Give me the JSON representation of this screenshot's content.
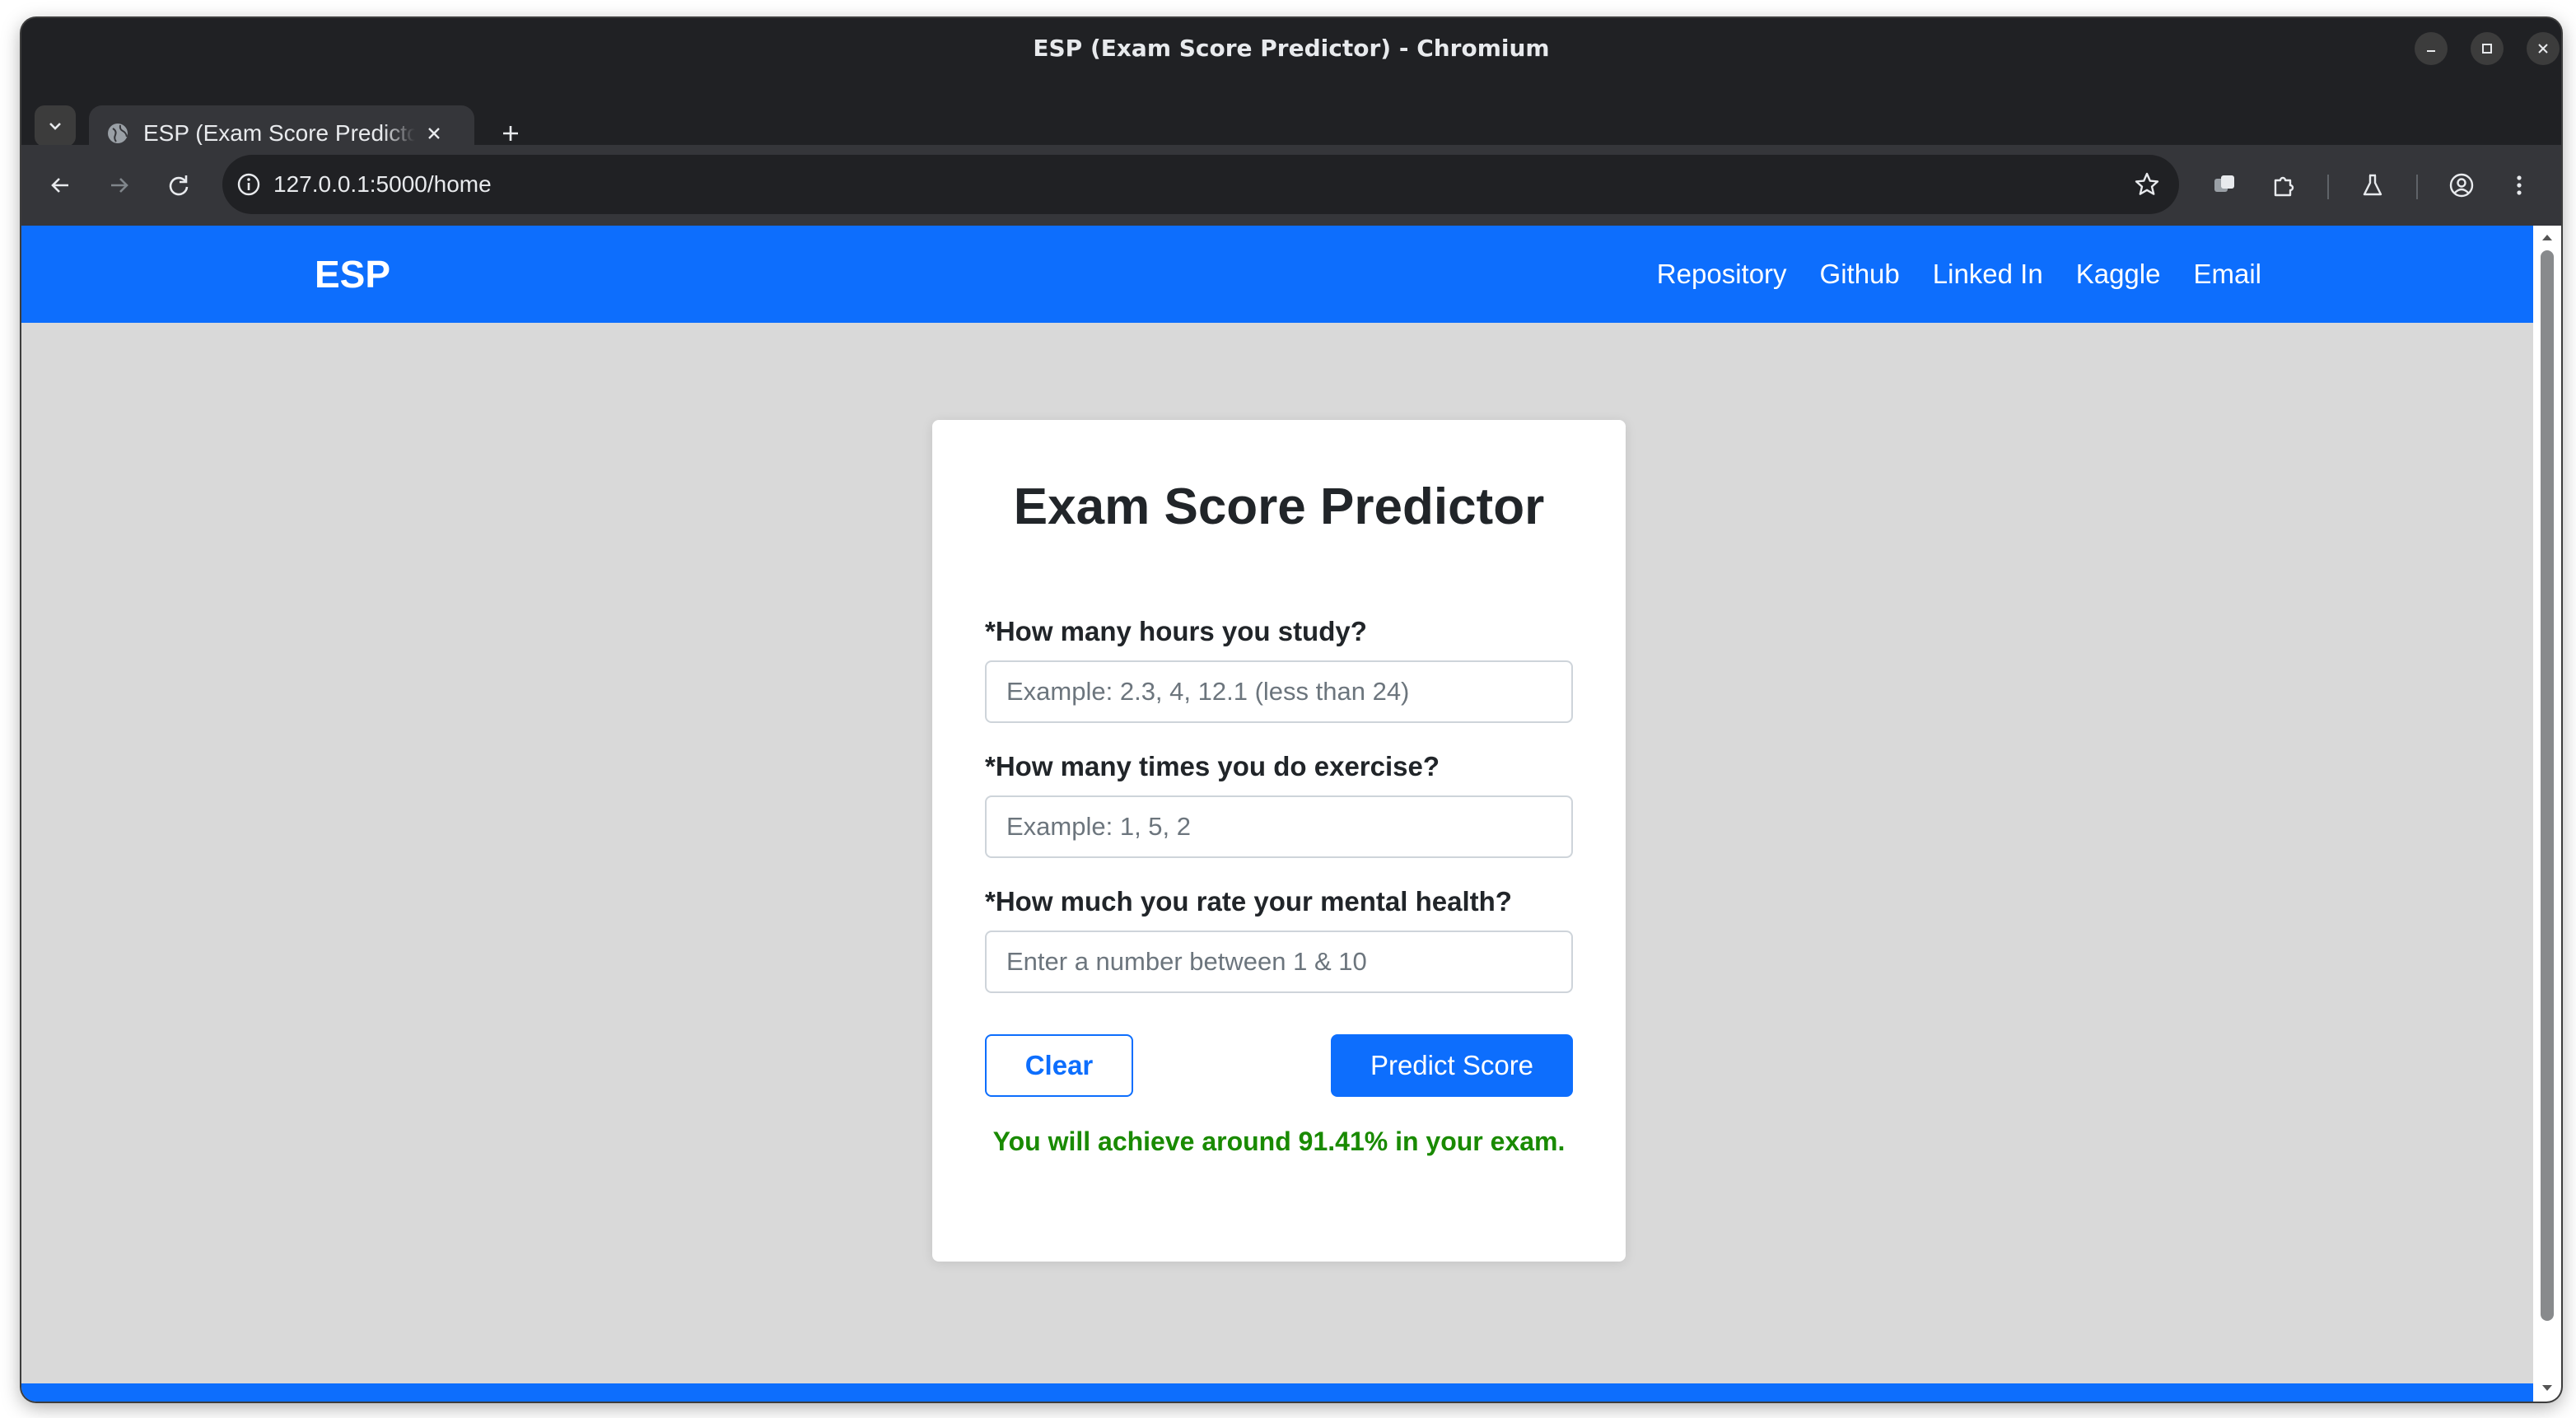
{
  "window": {
    "title": "ESP (Exam Score Predictor) - Chromium"
  },
  "tab": {
    "title": "ESP (Exam Score Predictor)"
  },
  "address_bar": {
    "url": "127.0.0.1:5000/home"
  },
  "navbar": {
    "brand": "ESP",
    "links": [
      "Repository",
      "Github",
      "Linked In",
      "Kaggle",
      "Email"
    ]
  },
  "form": {
    "title": "Exam Score Predictor",
    "fields": [
      {
        "label": "*How many hours you study?",
        "placeholder": "Example: 2.3, 4, 12.1 (less than 24)",
        "value": ""
      },
      {
        "label": "*How many times you do exercise?",
        "placeholder": "Example: 1, 5, 2",
        "value": ""
      },
      {
        "label": "*How much you rate your mental health?",
        "placeholder": "Enter a number between 1 & 10",
        "value": ""
      }
    ],
    "clear_label": "Clear",
    "predict_label": "Predict Score",
    "result": "You will achieve around 91.41% in your exam."
  },
  "colors": {
    "brand_blue": "#0d6efd",
    "result_green": "#198a00",
    "page_bg": "#d9d9d9"
  },
  "icons": [
    "tab-search-icon",
    "globe-icon",
    "close-icon",
    "plus-icon",
    "back-icon",
    "forward-icon",
    "reload-icon",
    "site-info-icon",
    "star-icon",
    "extension-puzzle-icon",
    "labs-flask-icon",
    "profile-icon",
    "more-vert-icon"
  ]
}
